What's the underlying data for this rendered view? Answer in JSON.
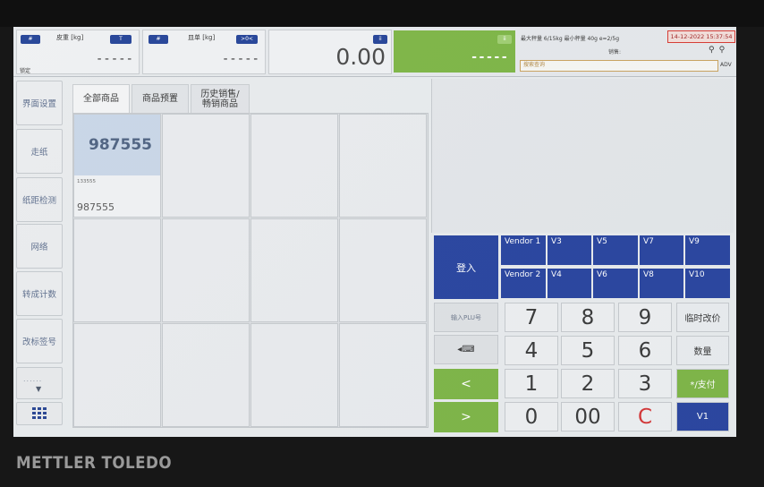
{
  "brand": "METTLER TOLEDO",
  "status": {
    "tare_label": "皮重 [kg]",
    "tare_value": "-----",
    "tare_sub": "锁定",
    "unit_label": "皿单 [kg]",
    "unit_value": "-----",
    "zero_pill": ">0<",
    "t_pill": "T",
    "hash_pill": "#",
    "hash_pill2": "#",
    "total_value": "0.00",
    "total_pill": "ii",
    "green_value": "-----",
    "green_pill": "ii",
    "capacity_text": "最大秤量 6/15kg 最小秤量 40g e=2/5g",
    "sale_label": "销售:",
    "datetime": "14-12-2022 15:37:54",
    "search_placeholder": "搜索查询",
    "adv_label": "ADV"
  },
  "sidebar": {
    "items": [
      {
        "label": "界面设置"
      },
      {
        "label": "走纸"
      },
      {
        "label": "纸距检测"
      },
      {
        "label": "网络"
      },
      {
        "label": "转成计数"
      },
      {
        "label": "改标签号"
      }
    ],
    "more_label": "......"
  },
  "tabs": [
    {
      "label": "全部商品"
    },
    {
      "label": "商品预置"
    },
    {
      "label": "历史销售/ 畅销商品"
    }
  ],
  "products": [
    {
      "name": "987555",
      "code": "133555",
      "plu": "987555"
    }
  ],
  "keypad": {
    "login": "登入",
    "vendors": [
      "Vendor 1",
      "V3",
      "V5",
      "V7",
      "V9",
      "Vendor 2",
      "V4",
      "V6",
      "V8",
      "V10"
    ],
    "plu_input": "输入PLU号",
    "keyboard_label": "◂⌨",
    "prev_arrow": "<",
    "next_arrow": ">",
    "keys": [
      "7",
      "8",
      "9",
      "4",
      "5",
      "6",
      "1",
      "2",
      "3",
      "0",
      "00",
      "C"
    ],
    "price_change": "临时改价",
    "quantity": "数量",
    "pay": "*/支付",
    "v1": "V1"
  },
  "colors": {
    "accent_blue": "#233f9c",
    "accent_green": "#7ab341",
    "alert_red": "#d6352c"
  }
}
